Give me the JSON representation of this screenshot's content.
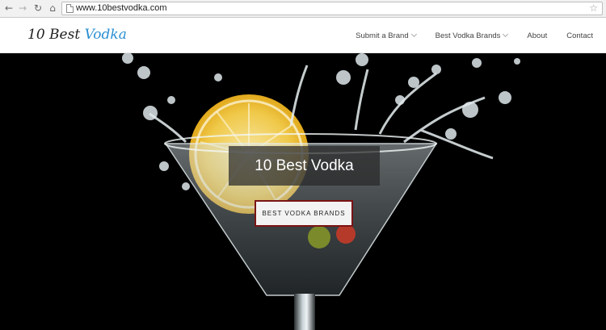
{
  "browser": {
    "url": "www.10bestvodka.com",
    "icons": [
      "back-arrow-icon",
      "forward-arrow-icon",
      "reload-icon",
      "home-icon",
      "page-icon",
      "bookmark-star-icon"
    ]
  },
  "header": {
    "logo_part1": "10 Best",
    "logo_part2": "Vodka",
    "logo_accent_color": "#2a8fd1",
    "nav": [
      {
        "label": "Submit a Brand",
        "has_dropdown": true
      },
      {
        "label": "Best Vodka Brands",
        "has_dropdown": true
      },
      {
        "label": "About",
        "has_dropdown": false
      },
      {
        "label": "Contact",
        "has_dropdown": false
      }
    ]
  },
  "hero": {
    "title": "10 Best Vodka",
    "button_label": "BEST VODKA BRANDS",
    "button_border_color": "#7a1414"
  }
}
